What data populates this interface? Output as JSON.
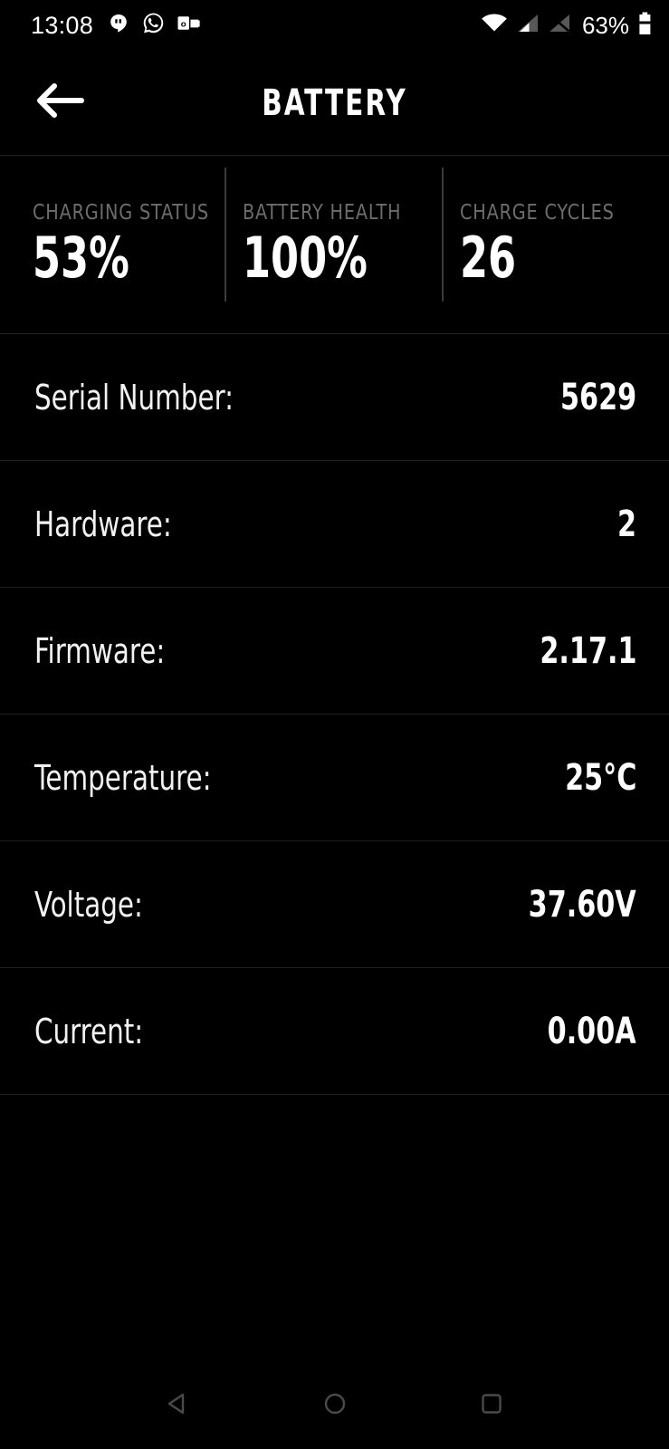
{
  "status_bar": {
    "time": "13:08",
    "left_icons": [
      "hangouts-icon",
      "whatsapp-icon",
      "outlook-icon"
    ],
    "right_icons": [
      "wifi-icon",
      "signal-icon",
      "no-sim-signal-icon"
    ],
    "battery_percent": "63%",
    "battery_icon": "battery-icon"
  },
  "app_bar": {
    "back_icon": "back-arrow-icon",
    "title": "BATTERY"
  },
  "stats": [
    {
      "label": "CHARGING STATUS",
      "value": "53%"
    },
    {
      "label": "BATTERY HEALTH",
      "value": "100%"
    },
    {
      "label": "CHARGE CYCLES",
      "value": "26"
    }
  ],
  "details": [
    {
      "label": "Serial Number:",
      "value": "5629"
    },
    {
      "label": "Hardware:",
      "value": "2"
    },
    {
      "label": "Firmware:",
      "value": "2.17.1"
    },
    {
      "label": "Temperature:",
      "value": "25°C"
    },
    {
      "label": "Voltage:",
      "value": "37.60V"
    },
    {
      "label": "Current:",
      "value": "0.00A"
    }
  ],
  "nav_bar": {
    "back": "nav-back-icon",
    "home": "nav-home-icon",
    "recents": "nav-recents-icon"
  },
  "colors": {
    "background": "#000000",
    "text_primary": "#ffffff",
    "text_muted": "#6d6d6d",
    "divider": "#1d1d1d",
    "nav_icon": "#4a4a4a"
  }
}
